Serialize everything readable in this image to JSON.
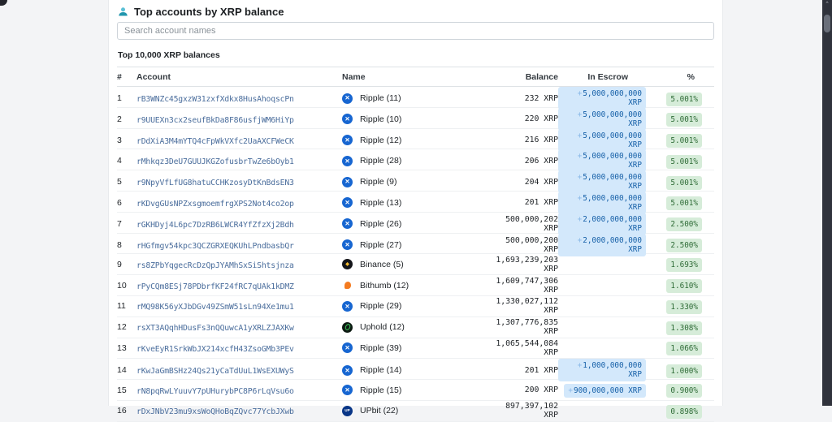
{
  "header": {
    "title": "Top accounts by XRP balance"
  },
  "search": {
    "placeholder": "Search account names"
  },
  "section": {
    "title": "Top 10,000 XRP balances"
  },
  "scrollbar": {
    "up_glyph": "⌃"
  },
  "colors": {
    "accent_teal": "#2b9eb3",
    "link_blue": "#4a6d9c",
    "escrow_badge_bg": "#d3e8fb",
    "escrow_badge_text": "#1660a8",
    "pct_badge_bg": "#d6ecd9",
    "pct_badge_text": "#2e6b36"
  },
  "icons": {
    "ripple": {
      "glyph": "✕",
      "label": "ripple-icon"
    },
    "binance": {
      "glyph": "◆",
      "label": "binance-icon"
    },
    "bithumb": {
      "glyph": "",
      "label": "bithumb-icon"
    },
    "uphold": {
      "glyph": "",
      "label": "uphold-icon"
    },
    "upbit": {
      "glyph": "UP",
      "label": "upbit-icon"
    }
  },
  "table": {
    "columns": [
      "#",
      "Account",
      "Name",
      "Balance",
      "In Escrow",
      "%"
    ],
    "escrow_prefix": "+",
    "rows": [
      {
        "rank": "1",
        "address": "rB3WNZc45gxzW31zxfXdkx8HusAhoqscPn",
        "icon": "ripple",
        "name": "Ripple (11)",
        "balance": "232 XRP",
        "escrow": "5,000,000,000 XRP",
        "pct": "5.001%"
      },
      {
        "rank": "2",
        "address": "r9UUEXn3cx2seufBkDa8F86usfjWM6HiYp",
        "icon": "ripple",
        "name": "Ripple (10)",
        "balance": "220 XRP",
        "escrow": "5,000,000,000 XRP",
        "pct": "5.001%"
      },
      {
        "rank": "3",
        "address": "rDdXiA3M4mYTQ4cFpWkVXfc2UaAXCFWeCK",
        "icon": "ripple",
        "name": "Ripple (12)",
        "balance": "216 XRP",
        "escrow": "5,000,000,000 XRP",
        "pct": "5.001%"
      },
      {
        "rank": "4",
        "address": "rMhkqz3DeU7GUUJKGZofusbrTwZe6bOyb1",
        "icon": "ripple",
        "name": "Ripple (28)",
        "balance": "206 XRP",
        "escrow": "5,000,000,000 XRP",
        "pct": "5.001%"
      },
      {
        "rank": "5",
        "address": "r9NpyVfLfUG8hatuCCHKzosyDtKnBdsEN3",
        "icon": "ripple",
        "name": "Ripple (9)",
        "balance": "204 XRP",
        "escrow": "5,000,000,000 XRP",
        "pct": "5.001%"
      },
      {
        "rank": "6",
        "address": "rKDvgGUsNPZxsgmoemfrgXPS2Not4co2op",
        "icon": "ripple",
        "name": "Ripple (13)",
        "balance": "201 XRP",
        "escrow": "5,000,000,000 XRP",
        "pct": "5.001%"
      },
      {
        "rank": "7",
        "address": "rGKHDyj4L6pc7DzRB6LWCR4YfZfzXj2Bdh",
        "icon": "ripple",
        "name": "Ripple (26)",
        "balance": "500,000,202 XRP",
        "escrow": "2,000,000,000 XRP",
        "pct": "2.500%"
      },
      {
        "rank": "8",
        "address": "rHGfmgv54kpc3QCZGRXEQKUhLPndbasbQr",
        "icon": "ripple",
        "name": "Ripple (27)",
        "balance": "500,000,200 XRP",
        "escrow": "2,000,000,000 XRP",
        "pct": "2.500%"
      },
      {
        "rank": "9",
        "address": "rs8ZPbYqgecRcDzQpJYAMhSxSiShtsjnza",
        "icon": "binance",
        "name": "Binance (5)",
        "balance": "1,693,239,203 XRP",
        "escrow": "",
        "pct": "1.693%"
      },
      {
        "rank": "10",
        "address": "rPyCQm8ESj78PDbrfKF24fRC7qUAk1kDMZ",
        "icon": "bithumb",
        "name": "Bithumb (12)",
        "balance": "1,609,747,306 XRP",
        "escrow": "",
        "pct": "1.610%"
      },
      {
        "rank": "11",
        "address": "rMQ98K56yXJbDGv49ZSmW51sLn94Xe1mu1",
        "icon": "ripple",
        "name": "Ripple (29)",
        "balance": "1,330,027,112 XRP",
        "escrow": "",
        "pct": "1.330%"
      },
      {
        "rank": "12",
        "address": "rsXT3AQqhHDusFs3nQQuwcA1yXRLZJAXKw",
        "icon": "uphold",
        "name": "Uphold (12)",
        "balance": "1,307,776,835 XRP",
        "escrow": "",
        "pct": "1.308%"
      },
      {
        "rank": "13",
        "address": "rKveEyR1SrkWbJX214xcfH43ZsoGMb3PEv",
        "icon": "ripple",
        "name": "Ripple (39)",
        "balance": "1,065,544,084 XRP",
        "escrow": "",
        "pct": "1.066%"
      },
      {
        "rank": "14",
        "address": "rKwJaGmBSHz24Qs21yCaTdUuL1WsEXUWyS",
        "icon": "ripple",
        "name": "Ripple (14)",
        "balance": "201 XRP",
        "escrow": "1,000,000,000 XRP",
        "pct": "1.000%"
      },
      {
        "rank": "15",
        "address": "rN8pqRwLYuuvY7pUHurybPC8P6rLqVsu6o",
        "icon": "ripple",
        "name": "Ripple (15)",
        "balance": "200 XRP",
        "escrow": "900,000,000 XRP",
        "pct": "0.900%"
      },
      {
        "rank": "16",
        "address": "rDxJNbV23mu9xsWoQHoBqZQvc77YcbJXwb",
        "icon": "upbit",
        "name": "UPbit (22)",
        "balance": "897,397,102 XRP",
        "escrow": "",
        "pct": "0.898%"
      }
    ]
  }
}
